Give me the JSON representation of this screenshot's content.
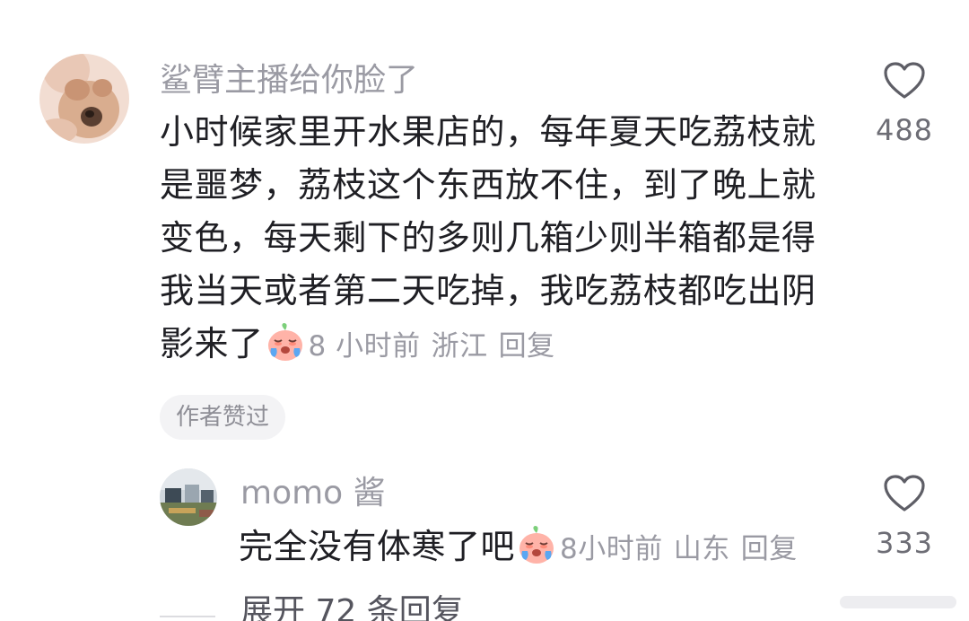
{
  "comment": {
    "username": "鲨臂主播给你脸了",
    "lines": [
      "小时候家里开水果店的，每年夏天吃荔枝就",
      "是噩梦，荔枝这个东西放不住，到了晚上就",
      "变色，每天剩下的多则几箱少则半箱都是得",
      "我当天或者第二天吃掉，我吃荔枝都吃出阴"
    ],
    "last_line_text": "影来了",
    "emoji": "crying-face-emoji",
    "time": "8 小时前",
    "location": "浙江",
    "reply_label": "回复",
    "like_count": "488",
    "author_badge": "作者赞过"
  },
  "reply": {
    "username": "momo 酱",
    "text": "完全没有体寒了吧",
    "emoji": "crying-face-emoji",
    "time": "8小时前",
    "location": "山东",
    "reply_label": "回复",
    "like_count": "333"
  },
  "expand_replies_label": "展开 72 条回复",
  "colors": {
    "text": "#1f1f24",
    "muted": "#9a9aa3",
    "badge_bg": "#f3f3f5"
  }
}
